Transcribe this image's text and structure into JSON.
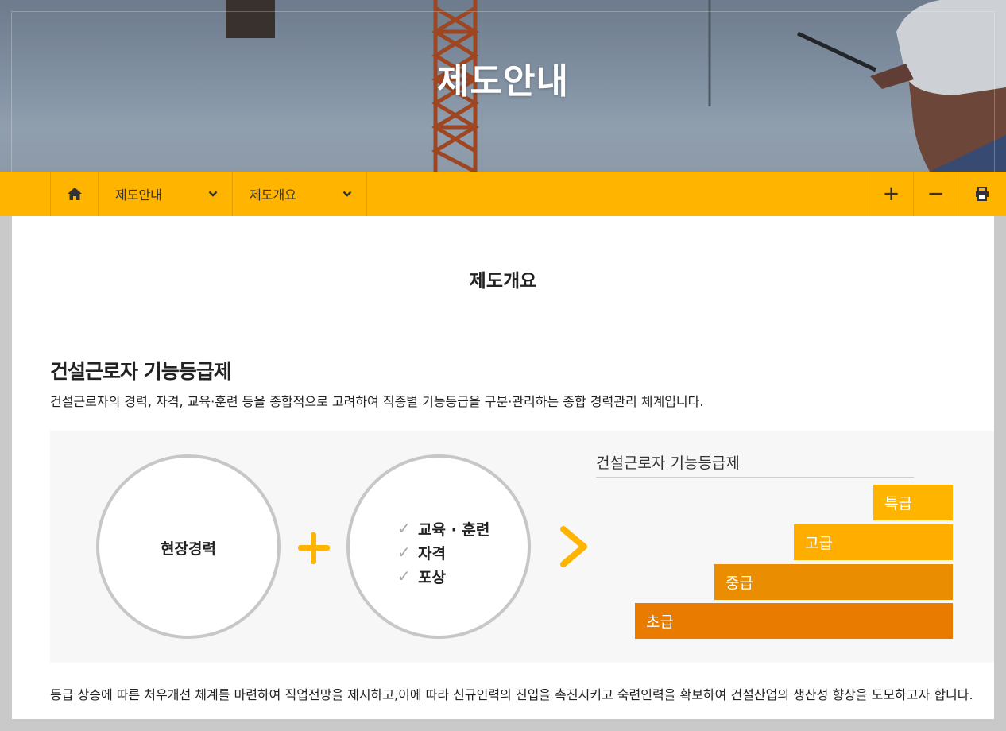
{
  "hero": {
    "title": "제도안내"
  },
  "nav": {
    "home_icon": "home-icon",
    "menu1": {
      "label": "제도안내",
      "icon": "chevron-down-icon"
    },
    "menu2": {
      "label": "제도개요",
      "icon": "chevron-down-icon"
    },
    "zoom_in": "+",
    "zoom_out": "−",
    "print_icon": "print-icon"
  },
  "main": {
    "page_title": "제도개요",
    "section_title": "건설근로자 기능등급제",
    "section_desc": "건설근로자의 경력, 자격, 교육·훈련 등을 종합적으로 고려하여 직종별 기능등급을 구분·관리하는 종합 경력관리 체계입니다.",
    "diagram": {
      "circle1": "현장경력",
      "checklist": [
        "교육 · 훈련",
        "자격",
        "포상"
      ],
      "chart_title": "건설근로자 기능등급제",
      "grades": [
        "특급",
        "고급",
        "중급",
        "초급"
      ]
    },
    "bottom_text": "등급 상승에 따른 처우개선 체계를 마련하여 직업전망을 제시하고,이에 따라 신규인력의 진입을 촉진시키고 숙련인력을 확보하여 건설산업의 생산성 향상을 도모하고자 합니다."
  },
  "colors": {
    "accent": "#ffb400",
    "grade_top": "#ffb400",
    "grade_high": "#ffae00",
    "grade_mid": "#eb8d00",
    "grade_low": "#e87b00"
  }
}
